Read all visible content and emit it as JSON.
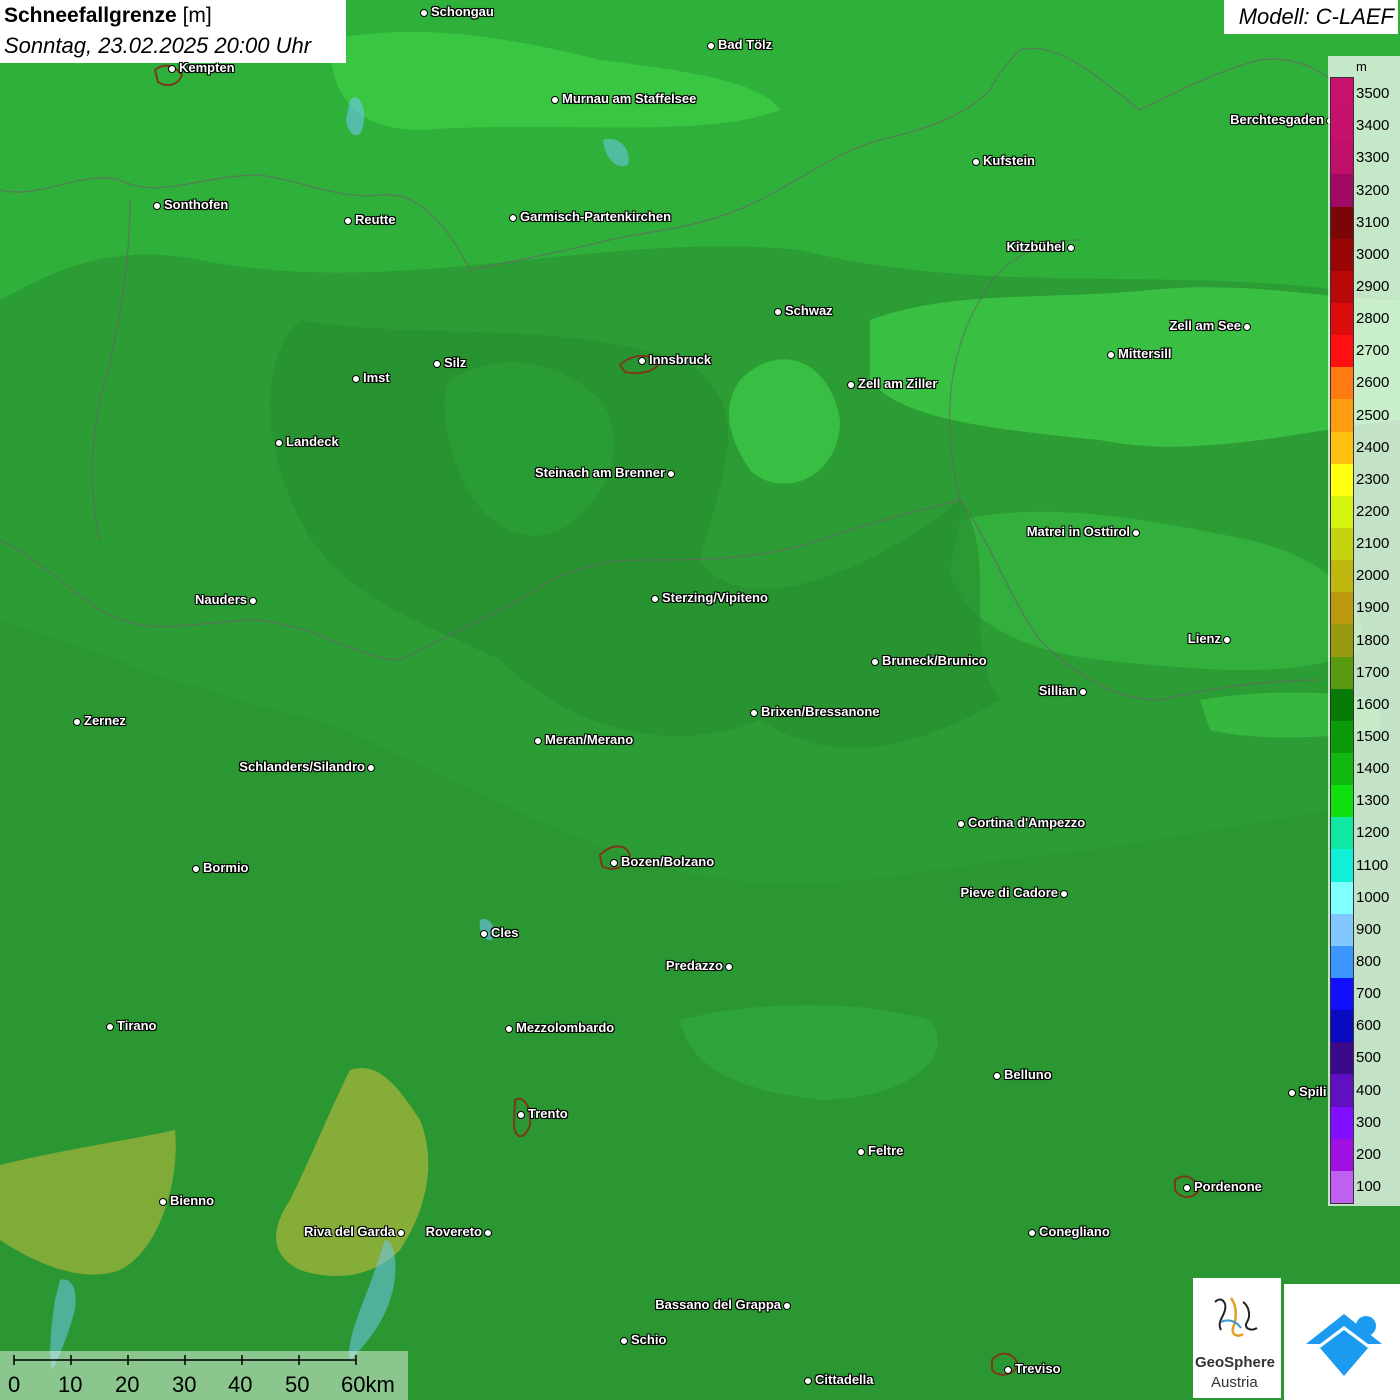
{
  "header": {
    "title": "Schneefallgrenze",
    "unit": "[m]",
    "datetime": "Sonntag, 23.02.2025 20:00 Uhr"
  },
  "model": "Modell: C-LAEF",
  "legend": {
    "unit": "m",
    "levels": [
      {
        "value": "3500",
        "color": "#c8106e"
      },
      {
        "value": "3400",
        "color": "#c5106c"
      },
      {
        "value": "3300",
        "color": "#c00f69"
      },
      {
        "value": "3200",
        "color": "#a00a64"
      },
      {
        "value": "3100",
        "color": "#7a0606"
      },
      {
        "value": "3000",
        "color": "#9a0606"
      },
      {
        "value": "2900",
        "color": "#b80808"
      },
      {
        "value": "2800",
        "color": "#dc0c0c"
      },
      {
        "value": "2700",
        "color": "#ff1010"
      },
      {
        "value": "2600",
        "color": "#ff7a10"
      },
      {
        "value": "2500",
        "color": "#ff9c10"
      },
      {
        "value": "2400",
        "color": "#ffc010"
      },
      {
        "value": "2300",
        "color": "#ffff10"
      },
      {
        "value": "2200",
        "color": "#d4f410"
      },
      {
        "value": "2100",
        "color": "#c6d410"
      },
      {
        "value": "2000",
        "color": "#c0b810"
      },
      {
        "value": "1900",
        "color": "#bc9a10"
      },
      {
        "value": "1800",
        "color": "#9a9a10"
      },
      {
        "value": "1700",
        "color": "#5a9a10"
      },
      {
        "value": "1600",
        "color": "#087a08"
      },
      {
        "value": "1500",
        "color": "#0a9a0a"
      },
      {
        "value": "1400",
        "color": "#10b810"
      },
      {
        "value": "1300",
        "color": "#10e010"
      },
      {
        "value": "1200",
        "color": "#10e8a0"
      },
      {
        "value": "1100",
        "color": "#10f0d8"
      },
      {
        "value": "1000",
        "color": "#80ffff"
      },
      {
        "value": "900",
        "color": "#80c8ff"
      },
      {
        "value": "800",
        "color": "#3c96ff"
      },
      {
        "value": "700",
        "color": "#1010ff"
      },
      {
        "value": "600",
        "color": "#0a0ac0"
      },
      {
        "value": "500",
        "color": "#3a0a8a"
      },
      {
        "value": "400",
        "color": "#6010c0"
      },
      {
        "value": "300",
        "color": "#8010ff"
      },
      {
        "value": "200",
        "color": "#a010e0"
      },
      {
        "value": "100",
        "color": "#c060f0"
      }
    ]
  },
  "cities": [
    {
      "name": "Schongau",
      "label_side": "right"
    },
    {
      "name": "Bad Tölz",
      "label_side": "right"
    },
    {
      "name": "Kempten",
      "label_side": "right"
    },
    {
      "name": "Murnau am Staffelsee",
      "label_side": "right"
    },
    {
      "name": "Berchtesgaden",
      "label_side": "left"
    },
    {
      "name": "Kufstein",
      "label_side": "right"
    },
    {
      "name": "Sonthofen",
      "label_side": "right"
    },
    {
      "name": "Reutte",
      "label_side": "right"
    },
    {
      "name": "Garmisch-Partenkirchen",
      "label_side": "right"
    },
    {
      "name": "Kitzbühel",
      "label_side": "left"
    },
    {
      "name": "Schwaz",
      "label_side": "right"
    },
    {
      "name": "Zell am See",
      "label_side": "left"
    },
    {
      "name": "Innsbruck",
      "label_side": "right"
    },
    {
      "name": "Mittersill",
      "label_side": "right"
    },
    {
      "name": "Silz",
      "label_side": "right"
    },
    {
      "name": "Imst",
      "label_side": "right"
    },
    {
      "name": "Zell am Ziller",
      "label_side": "right"
    },
    {
      "name": "Landeck",
      "label_side": "right"
    },
    {
      "name": "Steinach am Brenner",
      "label_side": "left"
    },
    {
      "name": "Matrei in Osttirol",
      "label_side": "left"
    },
    {
      "name": "Nauders",
      "label_side": "left"
    },
    {
      "name": "Sterzing/Vipiteno",
      "label_side": "right"
    },
    {
      "name": "Lienz",
      "label_side": "left"
    },
    {
      "name": "Bruneck/Brunico",
      "label_side": "right"
    },
    {
      "name": "Sillian",
      "label_side": "left"
    },
    {
      "name": "Zernez",
      "label_side": "right"
    },
    {
      "name": "Brixen/Bressanone",
      "label_side": "right"
    },
    {
      "name": "Meran/Merano",
      "label_side": "right"
    },
    {
      "name": "Schlanders/Silandro",
      "label_side": "left"
    },
    {
      "name": "Cortina d'Ampezzo",
      "label_side": "right"
    },
    {
      "name": "Bozen/Bolzano",
      "label_side": "right"
    },
    {
      "name": "Bormio",
      "label_side": "right"
    },
    {
      "name": "Pieve di Cadore",
      "label_side": "left"
    },
    {
      "name": "Cles",
      "label_side": "right"
    },
    {
      "name": "Predazzo",
      "label_side": "left"
    },
    {
      "name": "Tirano",
      "label_side": "right"
    },
    {
      "name": "Mezzolombardo",
      "label_side": "right"
    },
    {
      "name": "Belluno",
      "label_side": "right"
    },
    {
      "name": "Spili",
      "label_side": "right"
    },
    {
      "name": "Trento",
      "label_side": "right"
    },
    {
      "name": "Feltre",
      "label_side": "right"
    },
    {
      "name": "Pordenone",
      "label_side": "right"
    },
    {
      "name": "Bienno",
      "label_side": "right"
    },
    {
      "name": "Riva del Garda",
      "label_side": "left"
    },
    {
      "name": "Rovereto",
      "label_side": "left"
    },
    {
      "name": "Conegliano",
      "label_side": "right"
    },
    {
      "name": "Bassano del Grappa",
      "label_side": "left"
    },
    {
      "name": "Schio",
      "label_side": "right"
    },
    {
      "name": "Treviso",
      "label_side": "right"
    },
    {
      "name": "Cittadella",
      "label_side": "right"
    }
  ],
  "scale": {
    "labels": [
      "0",
      "10",
      "20",
      "30",
      "40",
      "50",
      "60km"
    ]
  },
  "logos": {
    "geosphere_line1": "GeoSphere",
    "geosphere_line2": "Austria"
  }
}
